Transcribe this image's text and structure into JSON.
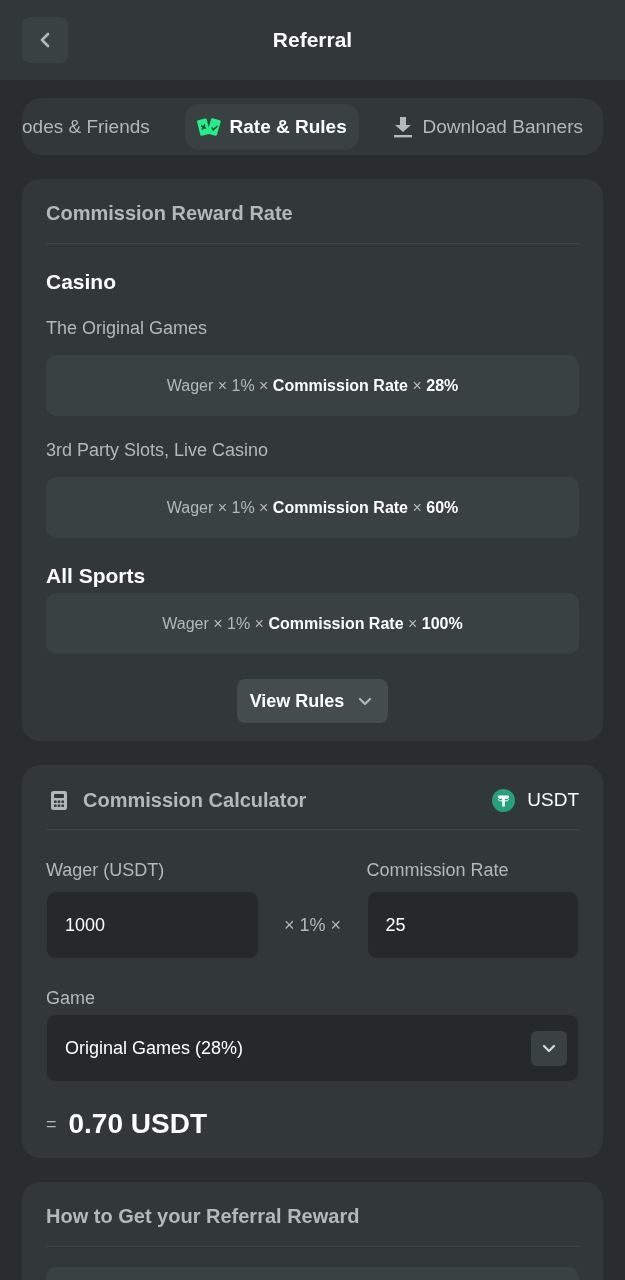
{
  "header": {
    "title": "Referral"
  },
  "tabs": [
    {
      "label": "odes & Friends",
      "selected": false
    },
    {
      "label": "Rate & Rules",
      "selected": true
    },
    {
      "label": "Download Banners",
      "selected": false
    }
  ],
  "reward_rate": {
    "title": "Commission Reward Rate",
    "sections": [
      {
        "heading": "Casino",
        "groups": [
          {
            "label": "The Original Games",
            "formula": "Wager × 1% × **Commission Rate** × **28%**"
          },
          {
            "label": "3rd Party Slots, Live Casino",
            "formula": "Wager × 1% × **Commission Rate** × **60%**"
          }
        ]
      },
      {
        "heading": "All Sports",
        "groups": [
          {
            "formula": "Wager × 1% × **Commission Rate** × **100%**"
          }
        ]
      }
    ],
    "button": "View Rules"
  },
  "calculator": {
    "title": "Commission Calculator",
    "currency": "USDT",
    "wager": {
      "label": "Wager (USDT)",
      "value": "1000"
    },
    "operator": "× 1% ×",
    "commission_rate": {
      "label": "Commission Rate",
      "value": "25"
    },
    "game": {
      "label": "Game",
      "value": "Original Games (28%)"
    },
    "equals": "=",
    "result": "0.70 USDT"
  },
  "referral_reward": {
    "title": "How to Get your Referral Reward"
  }
}
